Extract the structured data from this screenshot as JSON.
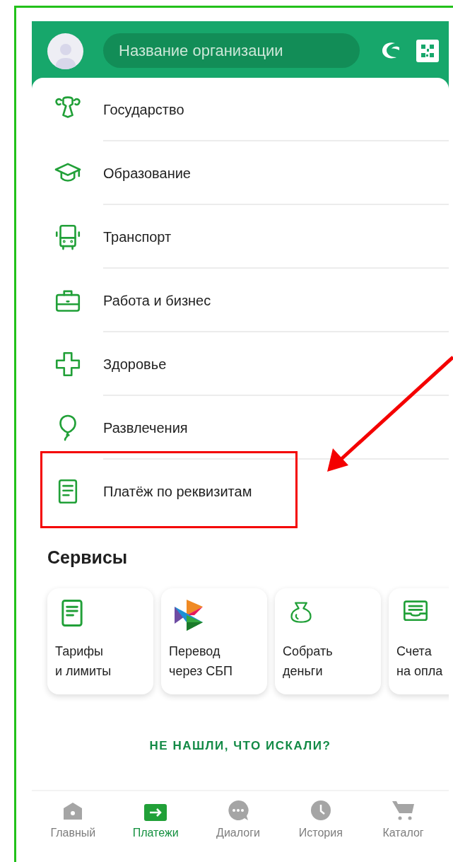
{
  "header": {
    "search": {
      "placeholder": "Название организации"
    }
  },
  "categories": [
    {
      "label": "Государство",
      "highlighted": false
    },
    {
      "label": "Образование",
      "highlighted": false
    },
    {
      "label": "Транспорт",
      "highlighted": false
    },
    {
      "label": "Работа и бизнес",
      "highlighted": false
    },
    {
      "label": "Здоровье",
      "highlighted": false
    },
    {
      "label": "Развлечения",
      "highlighted": false
    },
    {
      "label": "Платёж по реквизитам",
      "highlighted": true
    }
  ],
  "services": {
    "title": "Сервисы",
    "items": [
      {
        "label": "Тарифы\nи лимиты"
      },
      {
        "label": "Перевод\nчерез СБП"
      },
      {
        "label": "Собрать\nденьги"
      },
      {
        "label": "Счета\nна опла"
      }
    ]
  },
  "not_found_link": "НЕ НАШЛИ, ЧТО ИСКАЛИ?",
  "nav": [
    {
      "label": "Главный",
      "selected": false
    },
    {
      "label": "Платежи",
      "selected": true
    },
    {
      "label": "Диалоги",
      "selected": false
    },
    {
      "label": "История",
      "selected": false
    },
    {
      "label": "Каталог",
      "selected": false
    }
  ]
}
